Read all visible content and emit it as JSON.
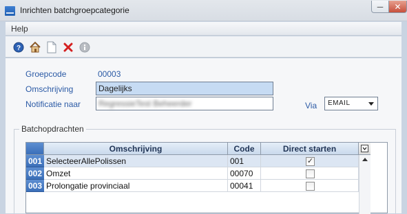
{
  "window": {
    "title": "Inrichten batchgroepcategorie",
    "minimize_glyph": "─",
    "close_glyph": "✕"
  },
  "menu": {
    "help": "Help"
  },
  "toolbar": {
    "icons": [
      "help-icon",
      "home-icon",
      "new-document-icon",
      "delete-icon",
      "info-icon"
    ]
  },
  "form": {
    "groepcode_label": "Groepcode",
    "groepcode_value": "00003",
    "omschrijving_label": "Omschrijving",
    "omschrijving_value": "Dagelijks",
    "notificatie_label": "Notificatie naar",
    "notificatie_value": "RegressieTest Beheerder",
    "via_label": "Via",
    "via_value": "EMAIL"
  },
  "batch": {
    "group_title": "Batchopdrachten",
    "columns": {
      "omschrijving": "Omschrijving",
      "code": "Code",
      "direct": "Direct starten"
    },
    "rows": [
      {
        "nr": "001",
        "omschrijving": "SelecteerAllePolissen",
        "code": "001",
        "direct": true
      },
      {
        "nr": "002",
        "omschrijving": "Omzet",
        "code": "00070",
        "direct": false
      },
      {
        "nr": "003",
        "omschrijving": "Prolongatie provinciaal",
        "code": "00041",
        "direct": false
      }
    ],
    "checkmark": "✓"
  },
  "colors": {
    "label_blue": "#2b5aa5",
    "selection": "#c6dbf3",
    "rownum_blue": "#3b6fb9"
  }
}
